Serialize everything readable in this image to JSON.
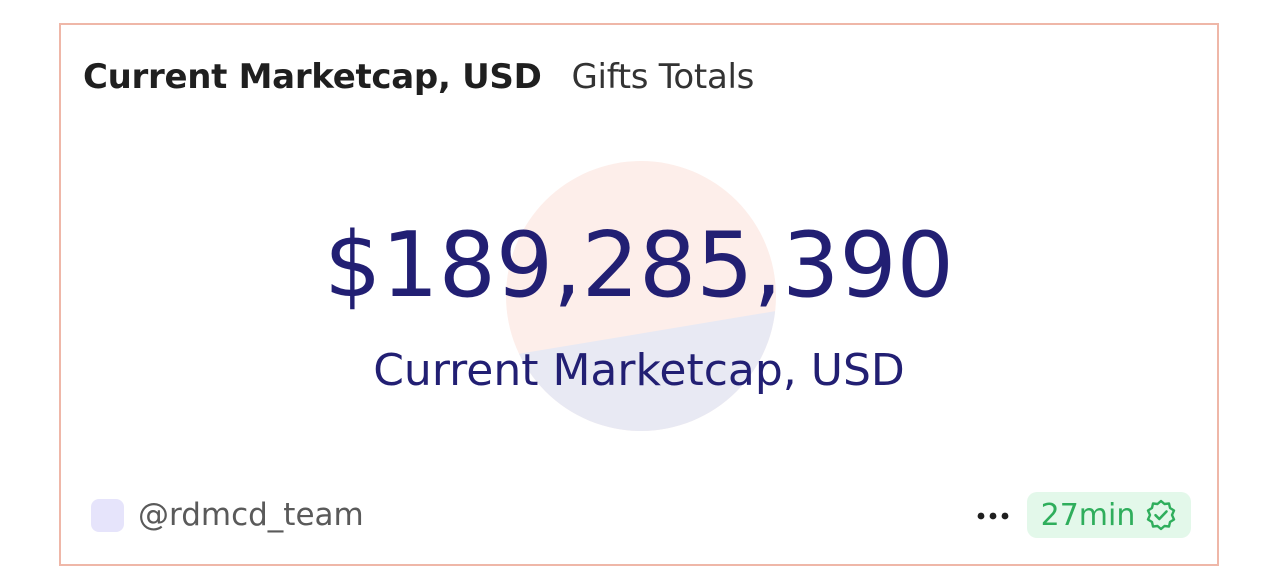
{
  "header": {
    "tabs": [
      {
        "label": "Current Marketcap, USD",
        "active": true
      },
      {
        "label": "Gifts Totals",
        "active": false
      }
    ]
  },
  "main": {
    "value": "$189,285,390",
    "caption": "Current Marketcap, USD"
  },
  "footer": {
    "handle": "@rdmcd_team",
    "more_icon": "ellipsis-icon",
    "time_label": "27min",
    "verified_icon": "verified-check-icon"
  },
  "colors": {
    "border": "#efb7a8",
    "value_text": "#221f73",
    "badge_bg": "#e3f8ea",
    "badge_text": "#2fae5c",
    "circle_top": "#fdeeea",
    "circle_bottom": "#e8e9f3"
  }
}
